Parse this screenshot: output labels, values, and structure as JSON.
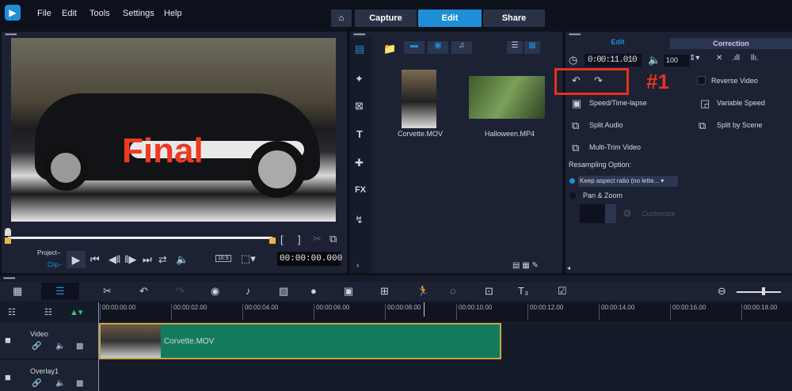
{
  "menu": {
    "items": [
      "File",
      "Edit",
      "Tools",
      "Settings",
      "Help"
    ]
  },
  "tabs": {
    "capture": "Capture",
    "edit": "Edit",
    "share": "Share"
  },
  "preview": {
    "overlay_text": "Final",
    "project_label": "Project",
    "clip_label": "Clip",
    "aspect": "16:9",
    "timecode": "00:00:00.000"
  },
  "library": {
    "items": [
      {
        "name": "Corvette.MOV"
      },
      {
        "name": "Halloween.MP4"
      }
    ]
  },
  "options": {
    "tab_edit": "Edit",
    "tab_correction": "Correction",
    "duration": "0:00:11.010",
    "volume": "100",
    "annotation": "#1",
    "reverse_video": "Reverse Video",
    "speed_timelapse": "Speed/Time-lapse",
    "variable_speed": "Variable Speed",
    "split_audio": "Split Audio",
    "split_by_scene": "Split by Scene",
    "multi_trim": "Multi-Trim Video",
    "resampling_label": "Resampling Option:",
    "resampling_value": "Keep aspect ratio (no lette...",
    "pan_zoom": "Pan & Zoom",
    "customize": "Customize",
    "accent": "#1e8fd6",
    "highlight": "#e8321e"
  },
  "timeline": {
    "ruler": [
      "00:00:00.00",
      "00:00:02.00",
      "00:00:04.00",
      "00:00:06.00",
      "00:00:08.00",
      "00:00:10.00",
      "00:00:12.00",
      "00:00:14.00",
      "00:00:16.00",
      "00:00:18.00"
    ],
    "tracks": [
      {
        "name": "Video"
      },
      {
        "name": "Overlay1"
      }
    ],
    "clip": "Corvette.MOV",
    "clip_color": "#137a5e"
  }
}
